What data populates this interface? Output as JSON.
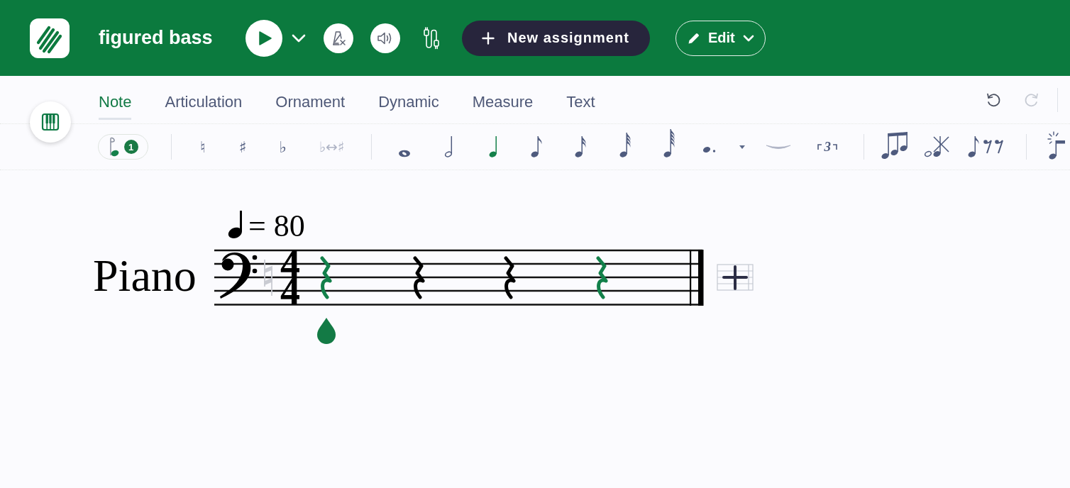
{
  "header": {
    "title": "figured bass",
    "new_assignment": "New assignment",
    "edit": "Edit"
  },
  "tabs": [
    {
      "label": "Note",
      "selected": true
    },
    {
      "label": "Articulation",
      "selected": false
    },
    {
      "label": "Ornament",
      "selected": false
    },
    {
      "label": "Dynamic",
      "selected": false
    },
    {
      "label": "Measure",
      "selected": false
    },
    {
      "label": "Text",
      "selected": false
    }
  ],
  "history": [
    {
      "kind": "undo",
      "disabled": false
    },
    {
      "kind": "redo",
      "disabled": true
    }
  ],
  "toolbar": {
    "groups": [
      {
        "items": [
          {
            "kind": "input",
            "badge": "1",
            "selected": false,
            "disabled": false
          }
        ]
      },
      {
        "items": [
          {
            "kind": "accidental",
            "label": "♮",
            "selected": false,
            "disabled": false
          },
          {
            "kind": "accidental",
            "label": "♯",
            "selected": false,
            "disabled": false
          },
          {
            "kind": "accidental",
            "label": "♭",
            "selected": false,
            "disabled": false
          },
          {
            "kind": "flip",
            "label": "♭↔♯",
            "selected": false,
            "disabled": true
          }
        ]
      },
      {
        "items": [
          {
            "kind": "whole",
            "selected": false,
            "disabled": false
          },
          {
            "kind": "half",
            "selected": false,
            "disabled": false
          },
          {
            "kind": "quarter",
            "selected": true,
            "disabled": false
          },
          {
            "kind": "eighth",
            "selected": false,
            "disabled": false
          },
          {
            "kind": "sixteenth",
            "selected": false,
            "disabled": false
          },
          {
            "kind": "thirtysecond",
            "selected": false,
            "disabled": false
          },
          {
            "kind": "sixtyfourth",
            "selected": false,
            "disabled": false
          },
          {
            "kind": "dot",
            "selected": false,
            "disabled": false
          },
          {
            "kind": "tie",
            "selected": false,
            "disabled": true
          },
          {
            "kind": "tuplet",
            "label": "3",
            "selected": false,
            "disabled": false
          }
        ]
      },
      {
        "items": [
          {
            "kind": "beam",
            "selected": false,
            "disabled": false
          },
          {
            "kind": "cross",
            "selected": false,
            "disabled": false
          },
          {
            "kind": "rests",
            "selected": false,
            "disabled": false
          }
        ]
      },
      {
        "items": [
          {
            "kind": "grace",
            "selected": false,
            "disabled": false
          }
        ]
      }
    ]
  },
  "score": {
    "tempo": "= 80",
    "instrument": "Piano",
    "time_signature": [
      "4",
      "4"
    ],
    "rests": [
      {
        "selected": true
      },
      {
        "selected": false
      },
      {
        "selected": false
      },
      {
        "selected": true
      }
    ]
  }
}
